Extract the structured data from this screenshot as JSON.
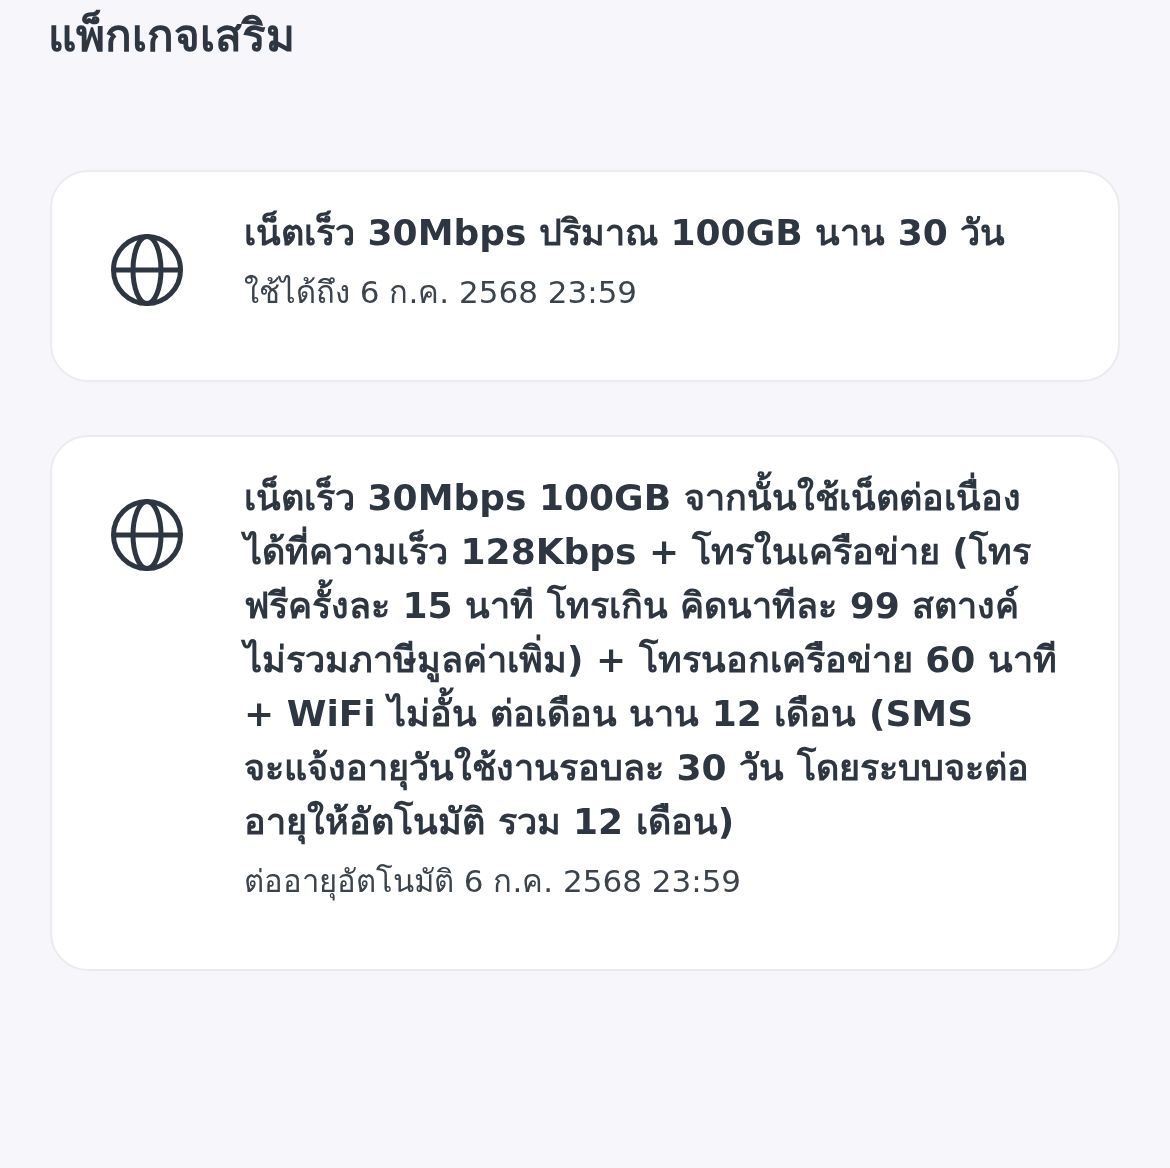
{
  "page": {
    "title": "แพ็กเกจเสริม"
  },
  "packages": [
    {
      "name": "เน็ตเร็ว 30Mbps ปริมาณ 100GB นาน 30 วัน",
      "validity": "ใช้ได้ถึง 6 ก.ค. 2568 23:59"
    },
    {
      "name": "เน็ตเร็ว 30Mbps 100GB จากนั้นใช้เน็ตต่อเนื่องได้ที่ความเร็ว 128Kbps + โทรในเครือข่าย (โทรฟรีครั้งละ 15 นาที โทรเกิน คิดนาทีละ 99 สตางค์ ไม่รวมภาษีมูลค่าเพิ่ม) + โทรนอกเครือข่าย 60 นาที + WiFi ไม่อั้น ต่อเดือน นาน 12 เดือน (SMS จะแจ้งอายุวันใช้งานรอบละ 30 วัน โดยระบบจะต่ออายุให้อัตโนมัติ รวม 12 เดือน)",
      "validity": "ต่ออายุอัตโนมัติ 6 ก.ค. 2568 23:59"
    }
  ]
}
